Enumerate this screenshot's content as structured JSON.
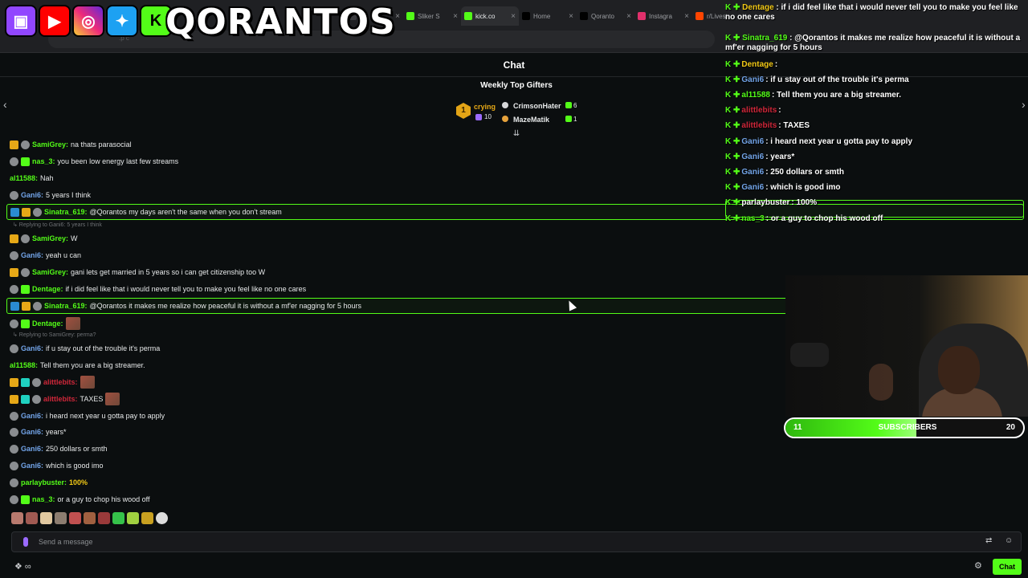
{
  "browser": {
    "tabs": [
      {
        "label": "",
        "active": false,
        "color": "#3a3b3f"
      },
      {
        "label": "Sliker S",
        "active": false,
        "color": "#53fc18"
      },
      {
        "label": "kick.co",
        "active": true,
        "color": "#53fc18"
      },
      {
        "label": "Home",
        "active": false,
        "color": "#000000"
      },
      {
        "label": "Qoranto",
        "active": false,
        "color": "#010101"
      },
      {
        "label": "Instagra",
        "active": false,
        "color": "#e1306c"
      },
      {
        "label": "r/Livest",
        "active": false,
        "color": "#ff4500"
      }
    ],
    "url_fragment": ".p c"
  },
  "banner": {
    "name": "QORANTOS",
    "icons": [
      "twitch-icon",
      "youtube-icon",
      "instagram-icon",
      "twitter-icon",
      "kick-icon"
    ]
  },
  "chat": {
    "title": "Chat",
    "gifters_title": "Weekly Top Gifters",
    "top_gifter": {
      "rank": "1",
      "name": "crying",
      "count": "10"
    },
    "gifters": [
      {
        "name": "CrimsonHater",
        "count": "6",
        "color": "#d7d8da"
      },
      {
        "name": "MazeMatik",
        "count": "1",
        "color": "#e6a23c"
      }
    ],
    "messages": [
      {
        "user": "SamiGrey",
        "color": "#53fc18",
        "text": "na thats parasocial",
        "badges": [
          "gold",
          "gray"
        ]
      },
      {
        "user": "nas_3",
        "color": "#53fc18",
        "text": "you been low energy last few streams",
        "badges": [
          "gray",
          "green"
        ]
      },
      {
        "user": "al11588",
        "color": "#53fc18",
        "text": "Nah",
        "badges": []
      },
      {
        "user": "Gani6",
        "color": "#72a4e8",
        "text": "5 years I think",
        "badges": [
          "gray"
        ]
      },
      {
        "user": "Sinatra_619",
        "color": "#53fc18",
        "text": "@Qorantos my days aren't the same when you don't stream",
        "badges": [
          "blue",
          "gold",
          "gray"
        ],
        "highlight": true
      },
      {
        "user": "SamiGrey",
        "color": "#53fc18",
        "text": "W",
        "badges": [
          "gold",
          "gray"
        ],
        "reply": "Replying to Gani6: 5 years I think"
      },
      {
        "user": "Gani6",
        "color": "#72a4e8",
        "text": "yeah u can",
        "badges": [
          "gray"
        ]
      },
      {
        "user": "SamiGrey",
        "color": "#53fc18",
        "text": "gani lets get married in 5 years so i can get citizenship too W",
        "badges": [
          "gold",
          "gray"
        ]
      },
      {
        "user": "Dentage",
        "color": "#53fc18",
        "text": "if i did feel like that i would never tell you to make you feel like no one cares",
        "badges": [
          "gray",
          "green"
        ]
      },
      {
        "user": "Sinatra_619",
        "color": "#53fc18",
        "text": "@Qorantos it makes me realize how peaceful it is without a mf'er nagging for 5 hours",
        "badges": [
          "blue",
          "gold",
          "gray"
        ],
        "highlight": true
      },
      {
        "user": "Dentage",
        "color": "#53fc18",
        "text": "",
        "badges": [
          "gray",
          "green"
        ],
        "emote": true
      },
      {
        "user": "Gani6",
        "color": "#72a4e8",
        "text": "if u stay out of the trouble it's perma",
        "badges": [
          "gray"
        ],
        "reply": "Replying to SamiGrey: perma?"
      },
      {
        "user": "al11588",
        "color": "#53fc18",
        "text": "Tell them you are a big streamer.",
        "badges": []
      },
      {
        "user": "alittlebits",
        "color": "#d0273a",
        "text": "",
        "badges": [
          "gold",
          "teal",
          "gray"
        ],
        "emote": true
      },
      {
        "user": "alittlebits",
        "color": "#d0273a",
        "text": "TAXES",
        "badges": [
          "gold",
          "teal",
          "gray"
        ],
        "emote": true
      },
      {
        "user": "Gani6",
        "color": "#72a4e8",
        "text": "i heard next year u gotta pay to apply",
        "badges": [
          "gray"
        ]
      },
      {
        "user": "Gani6",
        "color": "#72a4e8",
        "text": "years*",
        "badges": [
          "gray"
        ]
      },
      {
        "user": "Gani6",
        "color": "#72a4e8",
        "text": "250 dollars or smth",
        "badges": [
          "gray"
        ]
      },
      {
        "user": "Gani6",
        "color": "#72a4e8",
        "text": "which is good imo",
        "badges": [
          "gray"
        ]
      },
      {
        "user": "parlaybuster",
        "color": "#53fc18",
        "text": "",
        "badges": [
          "gray"
        ],
        "percent": "100%"
      },
      {
        "user": "nas_3",
        "color": "#53fc18",
        "text": "or a guy to chop his wood off",
        "badges": [
          "gray",
          "green"
        ]
      }
    ],
    "input_placeholder": "Send a message",
    "chat_button": "Chat"
  },
  "overlay": {
    "messages": [
      {
        "user": "Dentage",
        "color": "#f2c916",
        "text": ": if i did feel like that i would never tell you to make you feel like no one cares",
        "wrap": true
      },
      {
        "user": "Sinatra_619",
        "color": "#53fc18",
        "text": ": @Qorantos it makes me realize how peaceful it is without a mf'er nagging for 5 hours",
        "wrap": true
      },
      {
        "user": "Dentage",
        "color": "#f2c916",
        "text": ":"
      },
      {
        "user": "Gani6",
        "color": "#72a4e8",
        "text": ": if u stay out of the trouble it's perma"
      },
      {
        "user": "al11588",
        "color": "#53fc18",
        "text": ": Tell them you are a big streamer."
      },
      {
        "user": "alittlebits",
        "color": "#d0273a",
        "text": ":"
      },
      {
        "user": "alittlebits",
        "color": "#d0273a",
        "text": ": TAXES"
      },
      {
        "user": "Gani6",
        "color": "#72a4e8",
        "text": ": i heard next year u gotta pay to apply"
      },
      {
        "user": "Gani6",
        "color": "#72a4e8",
        "text": ": years*"
      },
      {
        "user": "Gani6",
        "color": "#72a4e8",
        "text": ": 250 dollars or smth"
      },
      {
        "user": "Gani6",
        "color": "#72a4e8",
        "text": ": which is good imo"
      },
      {
        "user": "parlaybuster",
        "color": "#ffffff",
        "text": ": 100%"
      },
      {
        "user": "nas_3",
        "color": "#53fc18",
        "text": ": or a guy to chop his wood off"
      }
    ]
  },
  "subscriber_goal": {
    "current": "11",
    "label": "SUBSCRIBERS",
    "target": "20",
    "progress": 0.55
  }
}
